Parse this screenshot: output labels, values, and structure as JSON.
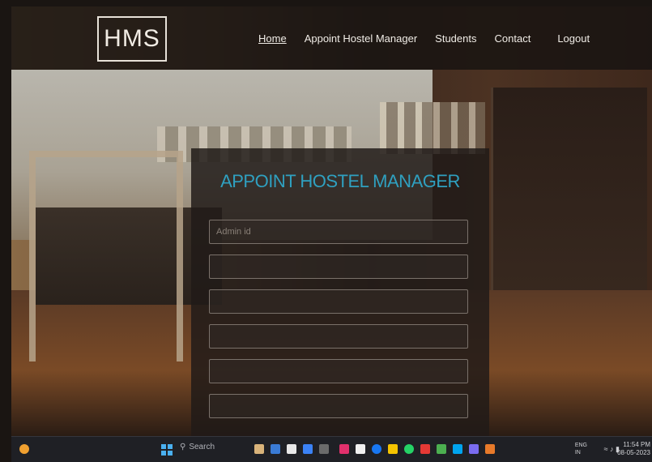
{
  "header": {
    "logo": "HMS",
    "nav": [
      {
        "label": "Home",
        "active": true
      },
      {
        "label": "Appoint Hostel Manager",
        "active": false
      },
      {
        "label": "Students",
        "active": false
      },
      {
        "label": "Contact",
        "active": false
      },
      {
        "label": "Logout",
        "active": false
      }
    ]
  },
  "form": {
    "title": "APPOINT HOSTEL MANAGER",
    "fields": [
      {
        "placeholder": "Admin id"
      },
      {
        "placeholder": ""
      },
      {
        "placeholder": ""
      },
      {
        "placeholder": ""
      },
      {
        "placeholder": ""
      },
      {
        "placeholder": ""
      }
    ]
  },
  "taskbar": {
    "search": "Search",
    "lang": "ENG",
    "region": "IN",
    "time": "11:54 PM",
    "date": "08-05-2023"
  },
  "colors": {
    "accent": "#2fa0c0",
    "navbar": "#19141280",
    "taskbar": "#1f2025"
  },
  "icons": [
    "weather-icon",
    "windows-start-icon",
    "search-icon",
    "app-icon",
    "wifi-icon",
    "volume-icon",
    "battery-icon"
  ]
}
